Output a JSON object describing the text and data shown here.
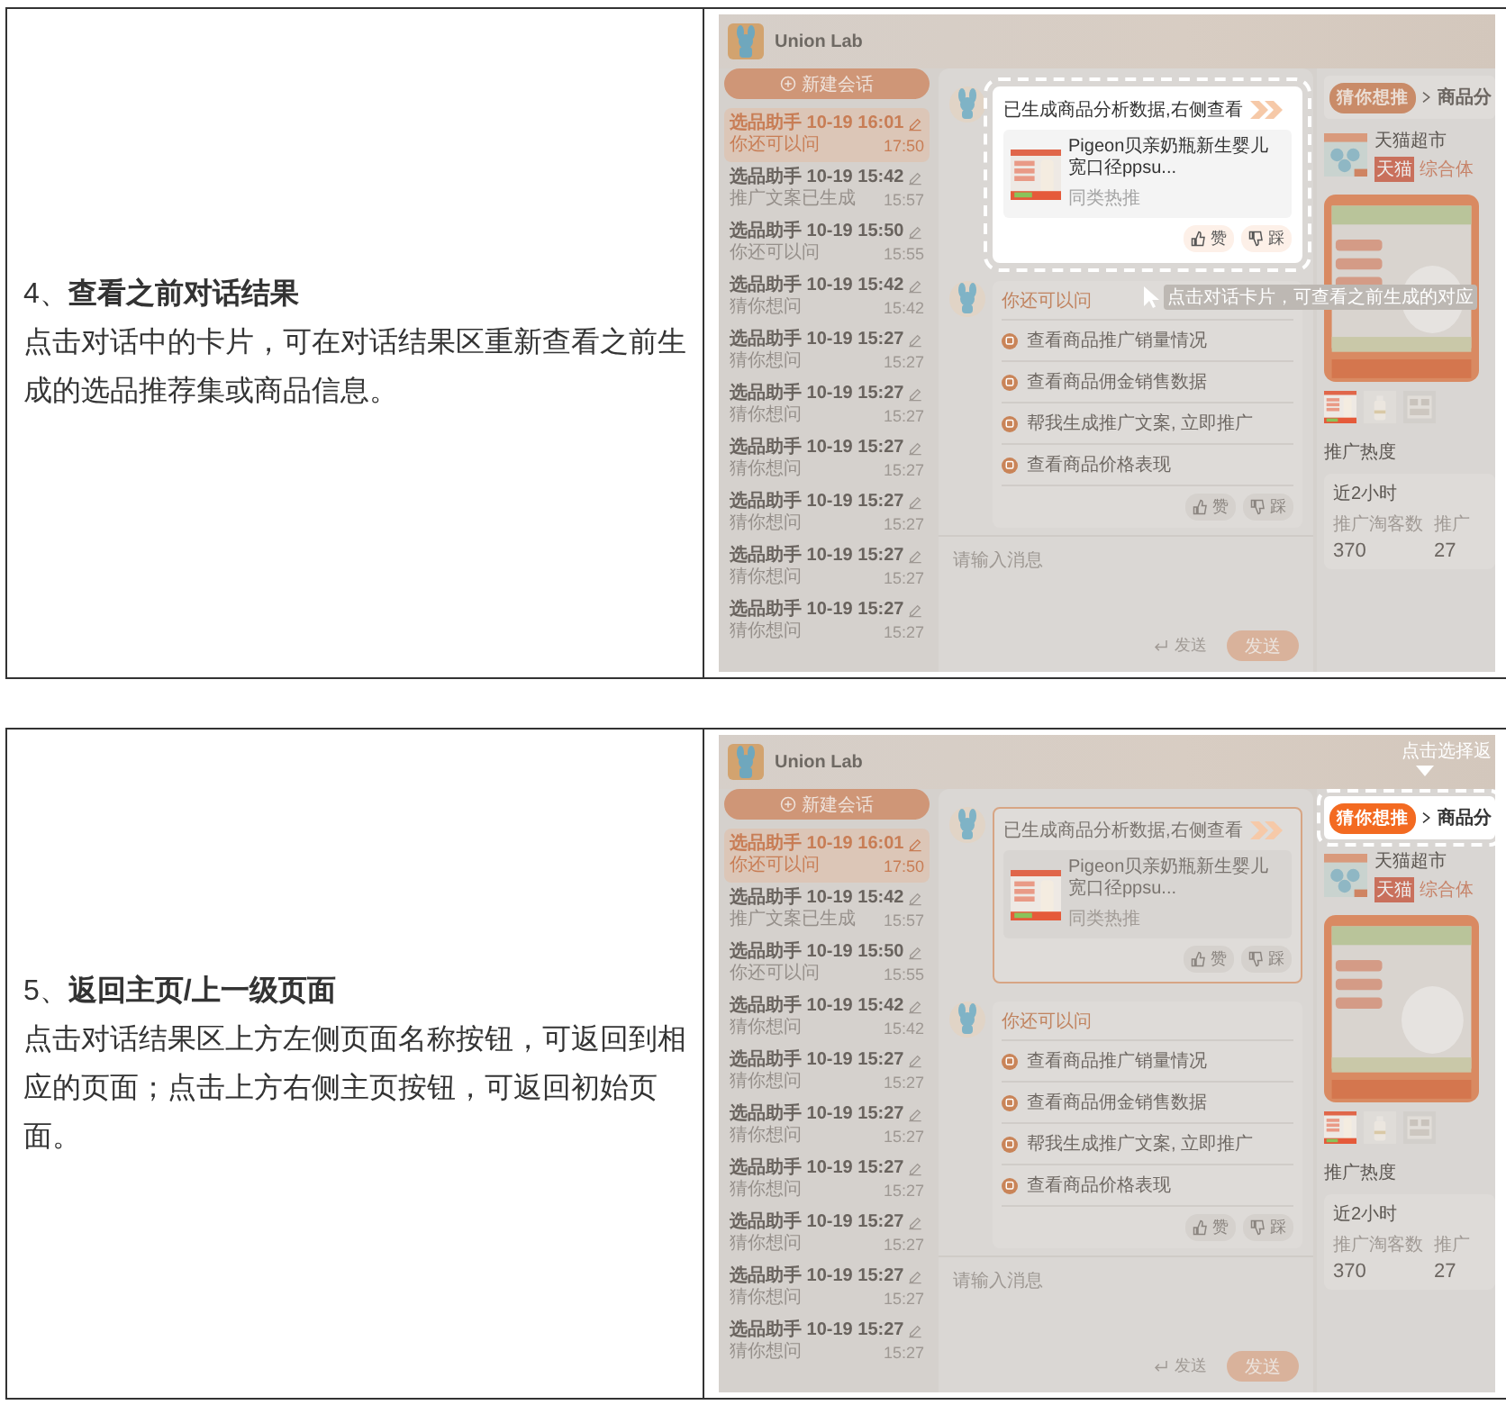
{
  "rows": [
    {
      "heading": "4、**查看之前对话结果**",
      "body": "点击对话中的卡片，可在对话结果区重新查看之前生成的选品推荐集或商品信息。",
      "screenshot": {
        "app_name": "Union Lab",
        "new_chat": "新建会话",
        "sessions": [
          {
            "title": "选品助手 10-19 16:01",
            "preview": "你还可以问",
            "time": "17:50",
            "selected": true
          },
          {
            "title": "选品助手 10-19 15:42",
            "preview": "推广文案已生成",
            "time": "15:57",
            "selected": false
          },
          {
            "title": "选品助手 10-19 15:50",
            "preview": "你还可以问",
            "time": "15:55",
            "selected": false
          },
          {
            "title": "选品助手 10-19 15:42",
            "preview": "猜你想问",
            "time": "15:42",
            "selected": false
          },
          {
            "title": "选品助手 10-19 15:27",
            "preview": "猜你想问",
            "time": "15:27",
            "selected": false
          },
          {
            "title": "选品助手 10-19 15:27",
            "preview": "猜你想问",
            "time": "15:27",
            "selected": false
          },
          {
            "title": "选品助手 10-19 15:27",
            "preview": "猜你想问",
            "time": "15:27",
            "selected": false
          },
          {
            "title": "选品助手 10-19 15:27",
            "preview": "猜你想问",
            "time": "15:27",
            "selected": false
          },
          {
            "title": "选品助手 10-19 15:27",
            "preview": "猜你想问",
            "time": "15:27",
            "selected": false
          },
          {
            "title": "选品助手 10-19 15:27",
            "preview": "猜你想问",
            "time": "15:27",
            "selected": false
          }
        ],
        "result_card": {
          "highlighted": true,
          "title": "已生成商品分析数据,右侧查看",
          "product": "Pigeon贝亲奶瓶新生婴儿宽口径ppsu...",
          "tag": "同类热推",
          "like": "赞",
          "dislike": "踩"
        },
        "suggestions": {
          "title": "你还可以问",
          "items": [
            "查看商品推广销量情况",
            "查看商品佣金销售数据",
            "帮我生成推广文案, 立即推广",
            "查看商品价格表现"
          ],
          "like": "赞",
          "dislike": "踩"
        },
        "input": {
          "placeholder": "请输入消息",
          "hint": "发送",
          "send": "发送"
        },
        "right_panel": {
          "breadcrumb_highlighted": false,
          "back": "猜你想推",
          "page": "商品分",
          "shop": "天猫超市",
          "badge": "天猫",
          "category": "综合体",
          "section": "推广热度",
          "period": "近2小时",
          "stats": [
            {
              "label": "推广淘客数",
              "value": "370"
            },
            {
              "label": "推广",
              "value": "27"
            }
          ]
        },
        "annotation": "点击对话卡片，可查看之前生成的对应"
      }
    },
    {
      "heading": "5、**返回主页/上一级页面**",
      "body": "点击对话结果区上方左侧页面名称按钮，可返回到相应的页面；点击上方右侧主页按钮，可返回初始页面。",
      "screenshot": {
        "app_name": "Union Lab",
        "new_chat": "新建会话",
        "sessions": [
          {
            "title": "选品助手 10-19 16:01",
            "preview": "你还可以问",
            "time": "17:50",
            "selected": true
          },
          {
            "title": "选品助手 10-19 15:42",
            "preview": "推广文案已生成",
            "time": "15:57",
            "selected": false
          },
          {
            "title": "选品助手 10-19 15:50",
            "preview": "你还可以问",
            "time": "15:55",
            "selected": false
          },
          {
            "title": "选品助手 10-19 15:42",
            "preview": "猜你想问",
            "time": "15:42",
            "selected": false
          },
          {
            "title": "选品助手 10-19 15:27",
            "preview": "猜你想问",
            "time": "15:27",
            "selected": false
          },
          {
            "title": "选品助手 10-19 15:27",
            "preview": "猜你想问",
            "time": "15:27",
            "selected": false
          },
          {
            "title": "选品助手 10-19 15:27",
            "preview": "猜你想问",
            "time": "15:27",
            "selected": false
          },
          {
            "title": "选品助手 10-19 15:27",
            "preview": "猜你想问",
            "time": "15:27",
            "selected": false
          },
          {
            "title": "选品助手 10-19 15:27",
            "preview": "猜你想问",
            "time": "15:27",
            "selected": false
          },
          {
            "title": "选品助手 10-19 15:27",
            "preview": "猜你想问",
            "time": "15:27",
            "selected": false
          }
        ],
        "result_card": {
          "highlighted": false,
          "title": "已生成商品分析数据,右侧查看",
          "product": "Pigeon贝亲奶瓶新生婴儿宽口径ppsu...",
          "tag": "同类热推",
          "like": "赞",
          "dislike": "踩"
        },
        "suggestions": {
          "title": "你还可以问",
          "items": [
            "查看商品推广销量情况",
            "查看商品佣金销售数据",
            "帮我生成推广文案, 立即推广",
            "查看商品价格表现"
          ],
          "like": "赞",
          "dislike": "踩"
        },
        "input": {
          "placeholder": "请输入消息",
          "hint": "发送",
          "send": "发送"
        },
        "right_panel": {
          "breadcrumb_highlighted": true,
          "back": "猜你想推",
          "page": "商品分",
          "shop": "天猫超市",
          "badge": "天猫",
          "category": "综合体",
          "section": "推广热度",
          "period": "近2小时",
          "stats": [
            {
              "label": "推广淘客数",
              "value": "370"
            },
            {
              "label": "推广",
              "value": "27"
            }
          ]
        },
        "annotation": "点击选择返"
      }
    }
  ]
}
